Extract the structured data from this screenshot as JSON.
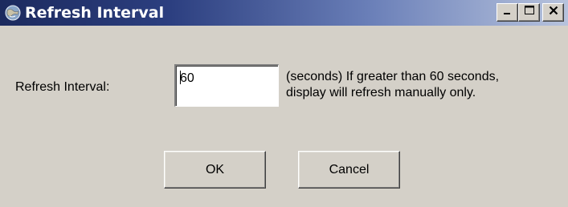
{
  "window": {
    "title": "Refresh Interval",
    "controls": {
      "minimize_icon": "minimize-icon",
      "maximize_icon": "maximize-icon",
      "close_icon": "close-icon"
    }
  },
  "form": {
    "label": "Refresh Interval:",
    "input_value": "60",
    "hint_line1": "(seconds) If greater than 60 seconds,",
    "hint_line2": "display will refresh manually only."
  },
  "buttons": {
    "ok_label": "OK",
    "cancel_label": "Cancel"
  },
  "colors": {
    "face": "#d4d0c8",
    "title_gradient_start": "#1c2a5e",
    "title_gradient_end": "#b7c3dd",
    "title_text": "#ffffff"
  }
}
